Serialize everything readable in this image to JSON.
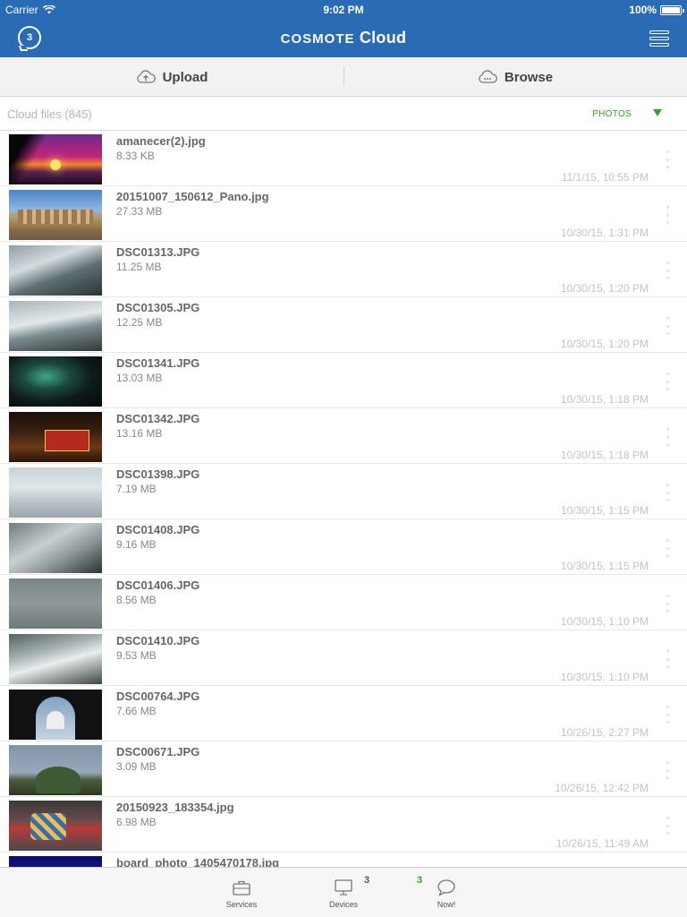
{
  "status_bar": {
    "carrier": "Carrier",
    "time": "9:02 PM",
    "battery": "100%",
    "battery_level": 1.0
  },
  "nav": {
    "brand": "COSMOTE",
    "title": "Cloud",
    "notification_count": "3",
    "left_icon": "chat-bubble-icon",
    "right_icon": "menu-icon"
  },
  "actions": {
    "upload_label": "Upload",
    "upload_icon": "cloud-upload-icon",
    "browse_label": "Browse",
    "browse_icon": "cloud-browse-icon"
  },
  "filter": {
    "label": "Cloud files (845)",
    "type": "PHOTOS",
    "accent_color": "#2fa12f"
  },
  "files": [
    {
      "name": "amanecer(2).jpg",
      "size": "8.33 KB",
      "date": "11/1/15, 10:55 PM",
      "thumb": "t-sunset"
    },
    {
      "name": "20151007_150612_Pano.jpg",
      "size": "27.33 MB",
      "date": "10/30/15, 1:31 PM",
      "thumb": "t-plaza"
    },
    {
      "name": "DSC01313.JPG",
      "size": "11.25 MB",
      "date": "10/30/15, 1:20 PM",
      "thumb": "t-falls1"
    },
    {
      "name": "DSC01305.JPG",
      "size": "12.25 MB",
      "date": "10/30/15, 1:20 PM",
      "thumb": "t-falls2"
    },
    {
      "name": "DSC01341.JPG",
      "size": "13.03 MB",
      "date": "10/30/15, 1:18 PM",
      "thumb": "t-night-green"
    },
    {
      "name": "DSC01342.JPG",
      "size": "13.16 MB",
      "date": "10/30/15, 1:18 PM",
      "thumb": "t-bus"
    },
    {
      "name": "DSC01398.JPG",
      "size": "7.19 MB",
      "date": "10/30/15, 1:15 PM",
      "thumb": "t-mist"
    },
    {
      "name": "DSC01408.JPG",
      "size": "9.16 MB",
      "date": "10/30/15, 1:15 PM",
      "thumb": "t-falls3"
    },
    {
      "name": "DSC01406.JPG",
      "size": "8.56 MB",
      "date": "10/30/15, 1:10 PM",
      "thumb": "t-grey"
    },
    {
      "name": "DSC01410.JPG",
      "size": "9.53 MB",
      "date": "10/30/15, 1:10 PM",
      "thumb": "t-falls4"
    },
    {
      "name": "DSC00764.JPG",
      "size": "7.66 MB",
      "date": "10/26/15, 2:27 PM",
      "thumb": "t-tajmahal"
    },
    {
      "name": "DSC00671.JPG",
      "size": "3.09 MB",
      "date": "10/26/15, 12:42 PM",
      "thumb": "t-tree"
    },
    {
      "name": "20150923_183354.jpg",
      "size": "6.98 MB",
      "date": "10/26/15, 11:49 AM",
      "thumb": "t-cow"
    },
    {
      "name": "board_photo_1405470178.jpg",
      "size": "",
      "date": "",
      "thumb": "t-board"
    }
  ],
  "tabbar": {
    "services_label": "Services",
    "services_icon": "briefcase-icon",
    "devices_label": "Devices",
    "devices_icon": "monitor-icon",
    "devices_badge": "3",
    "now_label": "Now!",
    "now_icon": "chat-icon",
    "now_badge": "3"
  }
}
